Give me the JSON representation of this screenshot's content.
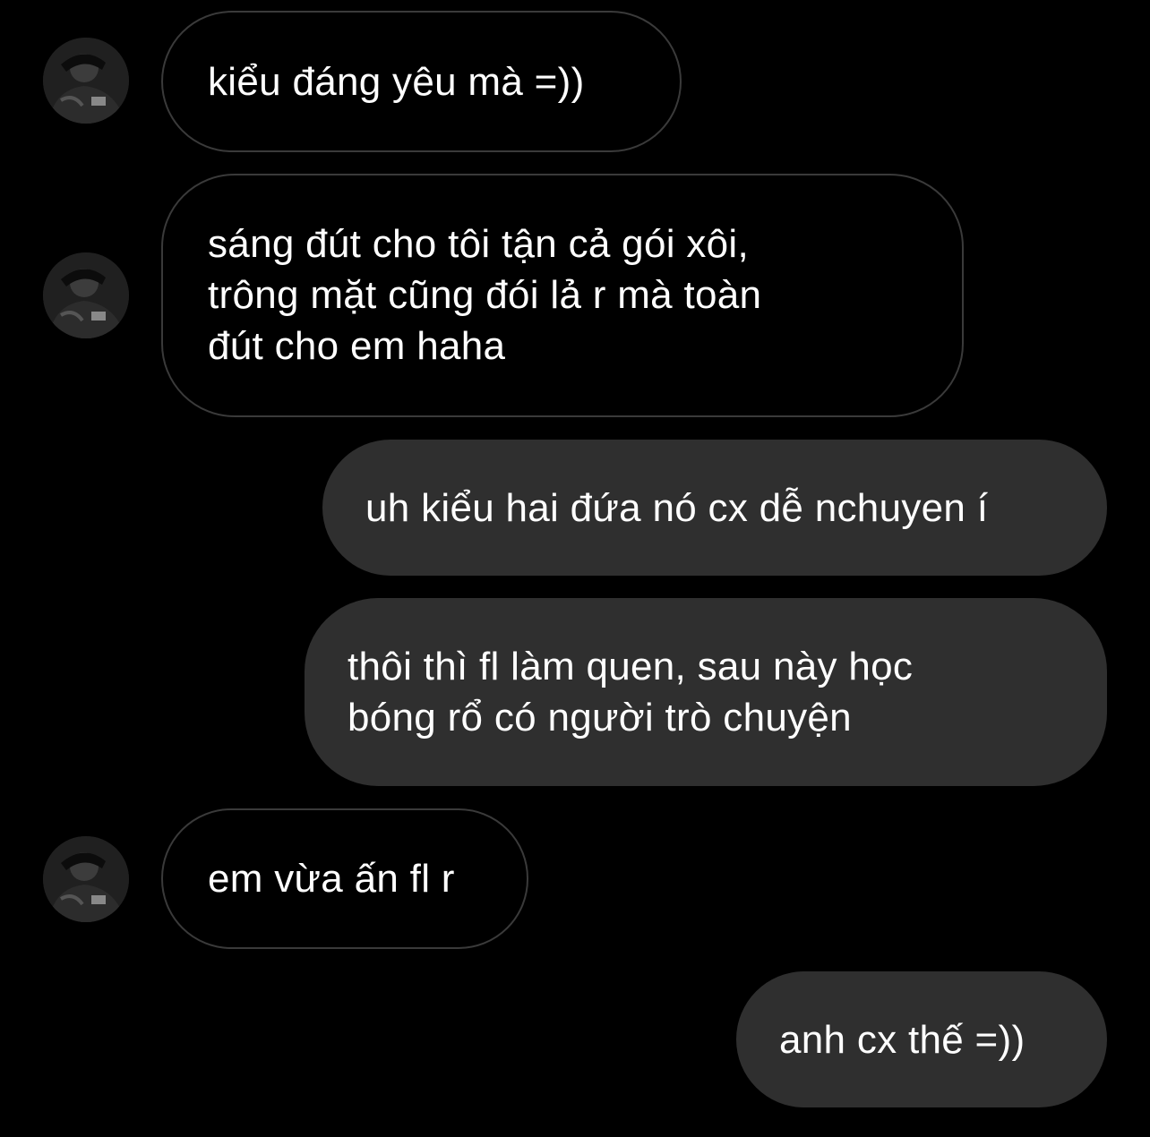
{
  "theme": {
    "background": "#000000",
    "incoming_bubble_border": "#3a3a3a",
    "outgoing_bubble_bg": "#2f2f2f",
    "text_color": "#ffffff"
  },
  "messages": [
    {
      "sender": "other",
      "avatar": "avatar-photo",
      "lines": [
        "kiểu đáng yêu mà =))"
      ]
    },
    {
      "sender": "other",
      "avatar": "avatar-photo",
      "lines": [
        "sáng đút cho tôi tận cả gói xôi,",
        "trông mặt cũng đói lả r mà toàn",
        "đút cho em haha"
      ]
    },
    {
      "sender": "me",
      "lines": [
        "uh kiểu hai đứa nó cx dễ nchuyen í"
      ]
    },
    {
      "sender": "me",
      "lines": [
        "thôi thì fl làm quen, sau này học",
        "bóng rổ có người trò chuyện"
      ]
    },
    {
      "sender": "other",
      "avatar": "avatar-photo",
      "lines": [
        "em vừa ấn fl r"
      ]
    },
    {
      "sender": "me",
      "lines": [
        "anh cx thế =))"
      ]
    }
  ]
}
